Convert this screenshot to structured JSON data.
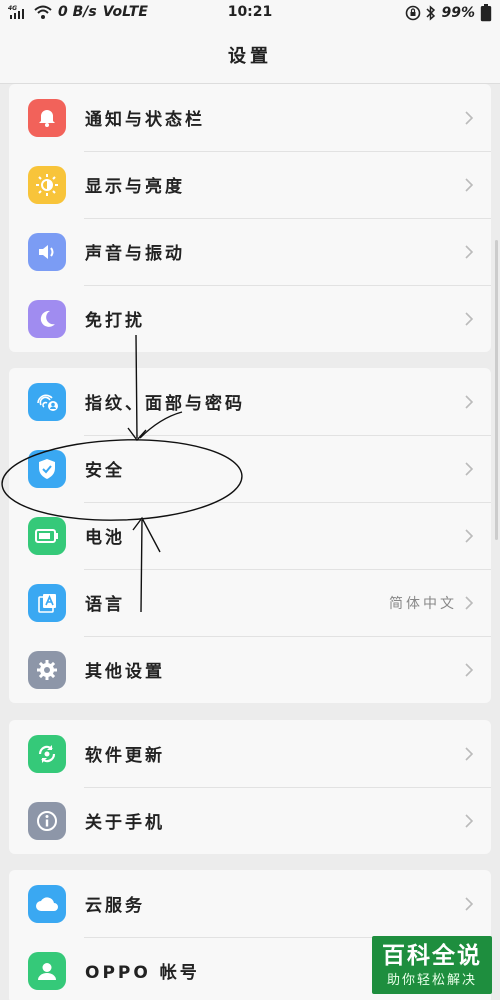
{
  "status_bar": {
    "network": "4G",
    "speed": "0 B/s",
    "volte": "VoLTE",
    "time": "10:21",
    "battery": "99%"
  },
  "header": {
    "title": "设置"
  },
  "groups": [
    {
      "items": [
        {
          "label": "通知与状态栏",
          "icon": "bell-icon",
          "color": "#f2625a"
        },
        {
          "label": "显示与亮度",
          "icon": "brightness-icon",
          "color": "#f8c43a"
        },
        {
          "label": "声音与振动",
          "icon": "speaker-icon",
          "color": "#7b9cf4"
        },
        {
          "label": "免打扰",
          "icon": "moon-icon",
          "color": "#a08cf0"
        }
      ]
    },
    {
      "items": [
        {
          "label": "指纹、面部与密码",
          "icon": "fingerprint-face-icon",
          "color": "#3aa8f2"
        },
        {
          "label": "安全",
          "icon": "shield-icon",
          "color": "#3aa8f2"
        },
        {
          "label": "电池",
          "icon": "battery-icon",
          "color": "#35c979"
        },
        {
          "label": "语言",
          "icon": "language-icon",
          "color": "#3aa8f2",
          "value": "简体中文"
        },
        {
          "label": "其他设置",
          "icon": "gear-icon",
          "color": "#8d96a8"
        }
      ]
    },
    {
      "items": [
        {
          "label": "软件更新",
          "icon": "update-icon",
          "color": "#35c979"
        },
        {
          "label": "关于手机",
          "icon": "info-icon",
          "color": "#8d96a8"
        }
      ]
    },
    {
      "items": [
        {
          "label": "云服务",
          "icon": "cloud-icon",
          "color": "#3aa8f2"
        },
        {
          "label": "OPPO 帐号",
          "icon": "account-icon",
          "color": "#35c979"
        }
      ]
    }
  ],
  "watermark": {
    "title": "百科全说",
    "subtitle": "助你轻松解决"
  }
}
